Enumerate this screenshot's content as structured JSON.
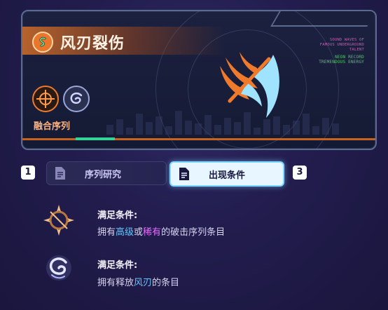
{
  "skill": {
    "title": "风刃裂伤",
    "fusion_label": "融合序列",
    "deco_lines": [
      "SOUND WAVES OF",
      "FAMOUS UNDERGROUND",
      "TALENT"
    ],
    "deco_green": [
      "NEON RECORD",
      "TREMENDOUS ENERGY"
    ]
  },
  "tabs": {
    "left_number": "1",
    "right_number": "3",
    "items": [
      {
        "label": "序列研究",
        "active": false
      },
      {
        "label": "出现条件",
        "active": true
      }
    ]
  },
  "conditions": [
    {
      "icon": "crossbow-sigil-icon",
      "title": "满足条件:",
      "segments": [
        {
          "text": "拥有",
          "style": ""
        },
        {
          "text": "高级",
          "style": "hl-blue"
        },
        {
          "text": "或",
          "style": ""
        },
        {
          "text": "稀有",
          "style": "hl-purple"
        },
        {
          "text": "的破击序列条目",
          "style": ""
        }
      ]
    },
    {
      "icon": "wind-swirl-icon",
      "title": "满足条件:",
      "segments": [
        {
          "text": "拥有释放",
          "style": ""
        },
        {
          "text": "风刃",
          "style": "hl-blue"
        },
        {
          "text": "的条目",
          "style": ""
        }
      ]
    }
  ],
  "colors": {
    "accent_orange": "#e8772b",
    "accent_cyan": "#7fd8ff",
    "highlight_blue": "#63c6ff",
    "highlight_purple": "#e76bff",
    "progress_green": "#34d399"
  }
}
